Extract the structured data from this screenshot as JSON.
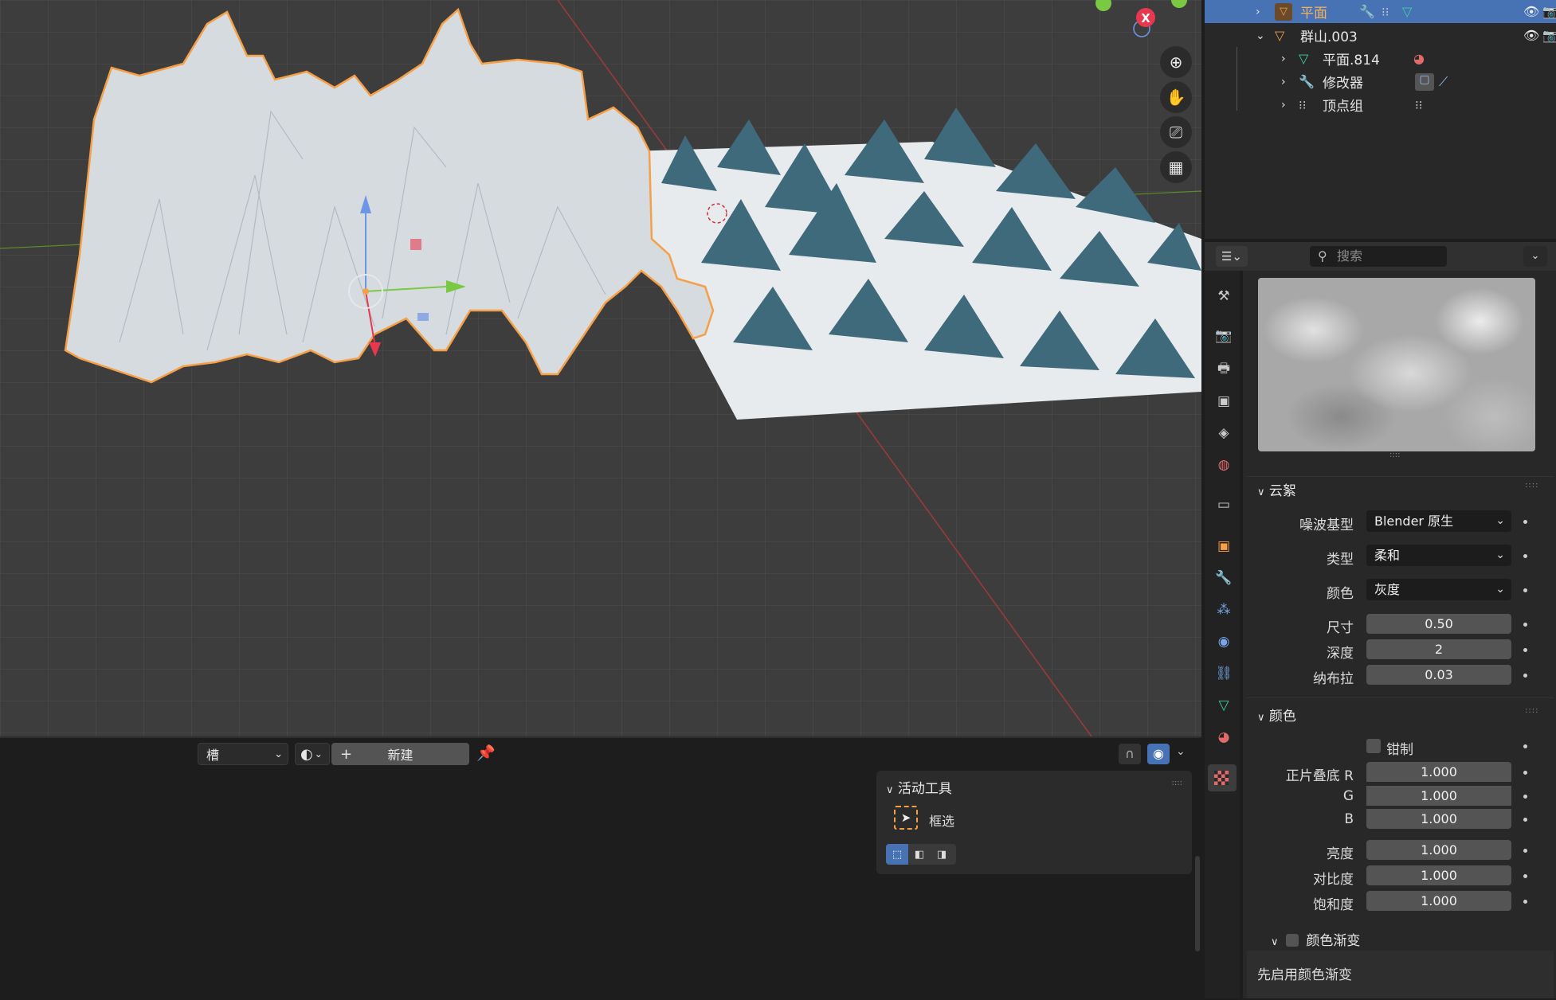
{
  "outliner": {
    "rows": [
      {
        "label": "平面"
      },
      {
        "label": "群山.003"
      },
      {
        "label": "平面.814"
      },
      {
        "label": "修改器"
      },
      {
        "label": "顶点组"
      }
    ]
  },
  "props": {
    "search_placeholder": "搜索",
    "section_clouds": "云絮",
    "noise_basis_label": "噪波基型",
    "noise_basis_value": "Blender 原生",
    "type_label": "类型",
    "type_value": "柔和",
    "color_label": "颜色",
    "color_value": "灰度",
    "size_label": "尺寸",
    "size_value": "0.50",
    "depth_label": "深度",
    "depth_value": "2",
    "nabla_label": "纳布拉",
    "nabla_value": "0.03",
    "section_color": "颜色",
    "clamp_label": "钳制",
    "multiply_r_label": "正片叠底 R",
    "multiply_r_value": "1.000",
    "g_label": "G",
    "g_value": "1.000",
    "b_label": "B",
    "b_value": "1.000",
    "brightness_label": "亮度",
    "brightness_value": "1.000",
    "contrast_label": "对比度",
    "contrast_value": "1.000",
    "saturation_label": "饱和度",
    "saturation_value": "1.000",
    "color_ramp_label": "颜色渐变",
    "ramp_note": "先启用颜色渐变"
  },
  "viewport": {
    "gizmo_x_label": "X"
  },
  "bottom_bar": {
    "slot_label": "槽",
    "new_label": "新建"
  },
  "active_tool": {
    "title": "活动工具",
    "tool_name": "框选"
  },
  "colors": {
    "accent_blue": "#4772b3",
    "selected_orange": "#f5a047",
    "x_axis_red": "#e8384f"
  }
}
